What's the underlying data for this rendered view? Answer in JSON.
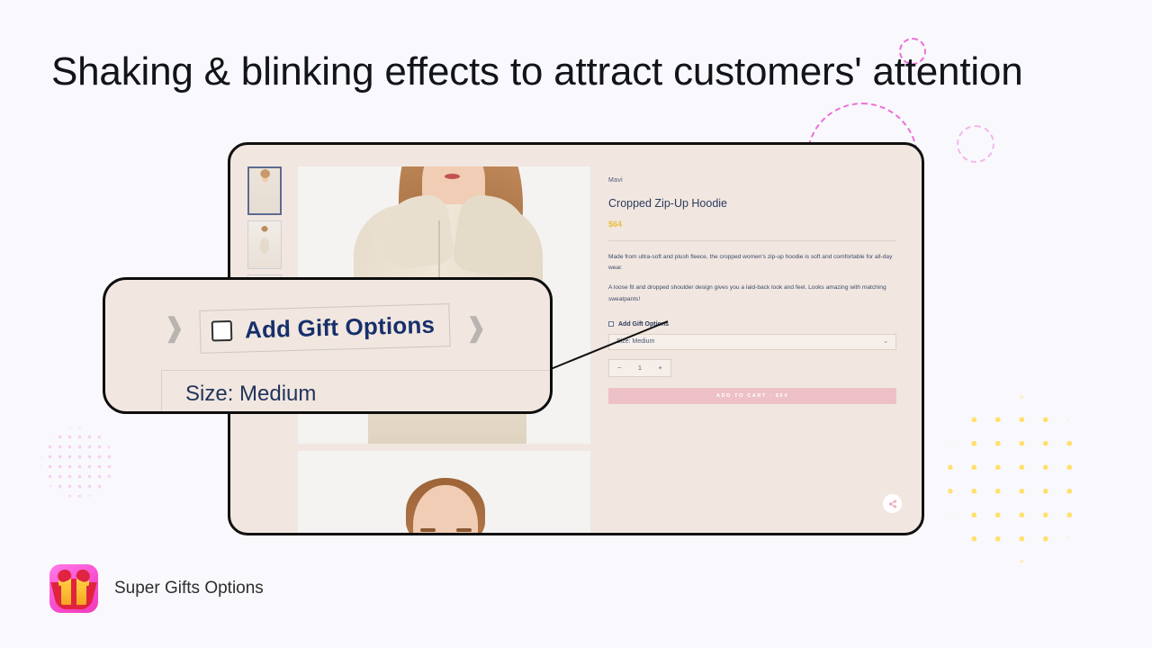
{
  "page": {
    "title": "Shaking & blinking effects to attract customers' attention",
    "background_color": "#f9f9fd"
  },
  "decorations": {
    "yellow_dots_color": "#ffe16b",
    "pink_dots_color": "#f7cbf0",
    "dashed_ring_color": "#f06ed8"
  },
  "store": {
    "thumbnails": [
      {
        "alt": "hoodie-front-open",
        "selected": true
      },
      {
        "alt": "hoodie-full-body",
        "selected": false
      },
      {
        "alt": "hoodie-detail",
        "selected": false
      }
    ],
    "gallery": {
      "main_alt": "model-wearing-cropped-zip-up-hoodie",
      "next_alt": "model-portrait-second-photo"
    },
    "product": {
      "brand": "Mavi",
      "name": "Cropped Zip-Up Hoodie",
      "price": "$64",
      "price_color": "#e8bf3e",
      "description_1": "Made from ultra-soft and plush fleece, the cropped women's zip-up hoodie is soft and comfortable for all-day wear.",
      "description_2": "A loose fit and dropped shoulder design gives you a laid-back look and feel. Looks amazing with matching sweatpants!"
    },
    "options": {
      "gift_label": "Add Gift Options",
      "gift_checked": false,
      "size_value": "Size: Medium",
      "chevron_icon": "⌄"
    },
    "quantity": {
      "minus": "−",
      "value": "1",
      "plus": "+"
    },
    "add_to_cart": {
      "label": "ADD TO CART  ·  $64",
      "color": "#eec0c7"
    },
    "share_icon": "share-icon"
  },
  "callout": {
    "gift_label": "Add Gift Options",
    "size_value": "Size: Medium",
    "shake_left": "❱",
    "shake_right": "❱",
    "checkbox_checked": false
  },
  "footer": {
    "app_name": "Super Gifts Options",
    "app_icon": "gift-box-icon"
  }
}
